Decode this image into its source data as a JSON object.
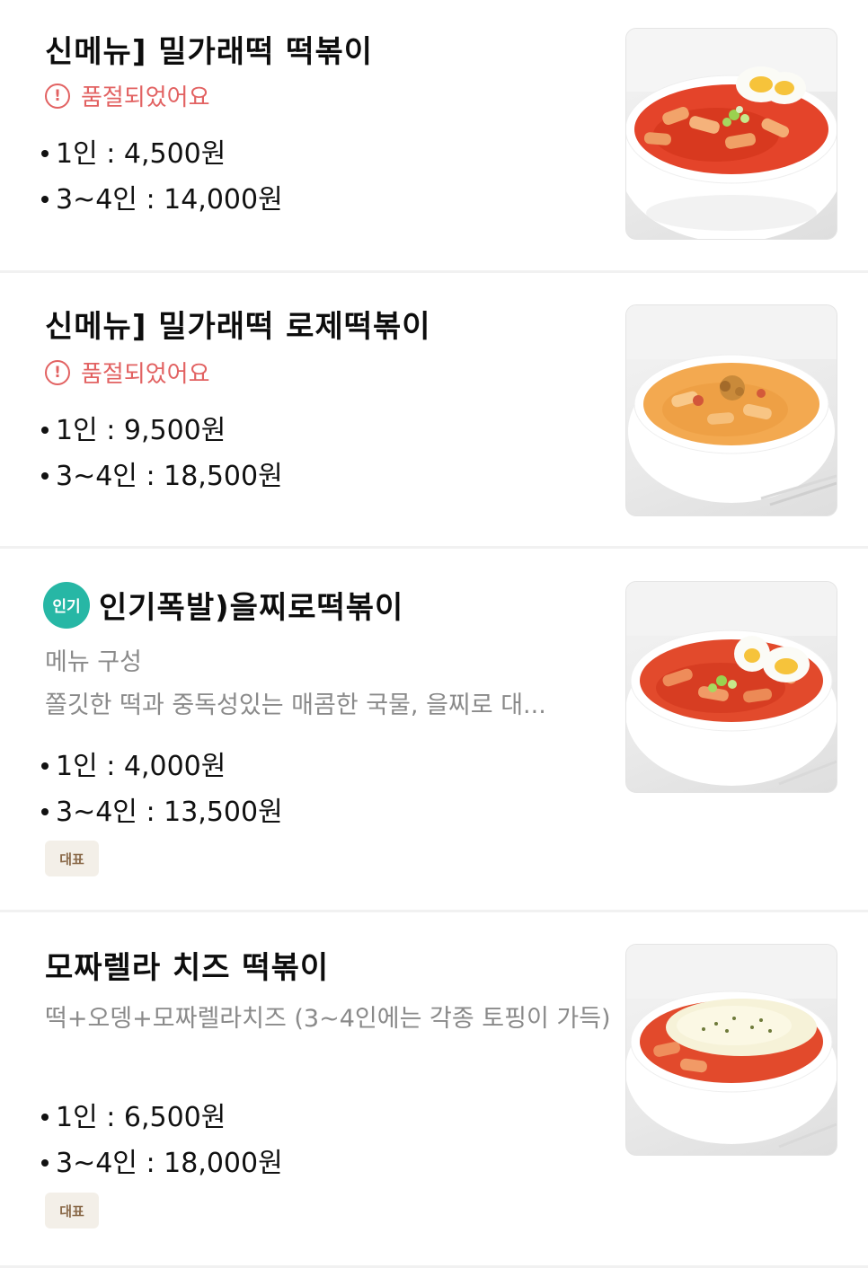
{
  "items": [
    {
      "title": "신메뉴] 밀가래떡 떡볶이",
      "status": "품절되었어요",
      "status_icon": "alert-circle-icon",
      "prices": [
        {
          "label": "1인",
          "price": "4,500원"
        },
        {
          "label": "3~4인",
          "price": "14,000원"
        }
      ],
      "image_icon": "red-tteokbokki-egg-photo"
    },
    {
      "title": "신메뉴]  밀가래떡 로제떡볶이",
      "status": "품절되었어요",
      "status_icon": "alert-circle-icon",
      "prices": [
        {
          "label": "1인",
          "price": "9,500원"
        },
        {
          "label": "3~4인",
          "price": "18,500원"
        }
      ],
      "image_icon": "rose-tteokbokki-photo"
    },
    {
      "badge": "인기",
      "title": "인기폭발)을찌로떡볶이",
      "desc_heading": "메뉴 구성",
      "description": "쫄깃한 떡과 중독성있는 매콤한 국물, 을찌로 대...",
      "prices": [
        {
          "label": "1인",
          "price": "4,000원"
        },
        {
          "label": "3~4인",
          "price": "13,500원"
        }
      ],
      "tag": "대표",
      "image_icon": "eulji-tteokbokki-egg-photo"
    },
    {
      "title": "모짜렐라 치즈 떡볶이",
      "description": "떡+오뎅+모짜렐라치즈 (3~4인에는 각종 토핑이 가득)",
      "prices": [
        {
          "label": "1인",
          "price": "6,500원"
        },
        {
          "label": "3~4인",
          "price": "18,000원"
        }
      ],
      "tag": "대표",
      "image_icon": "cheese-tteokbokki-photo"
    }
  ],
  "colors": {
    "soldout": "#e26262",
    "popular_badge": "#27b7a5",
    "tag_bg": "#f3efe8",
    "description": "#8a8a8a"
  }
}
